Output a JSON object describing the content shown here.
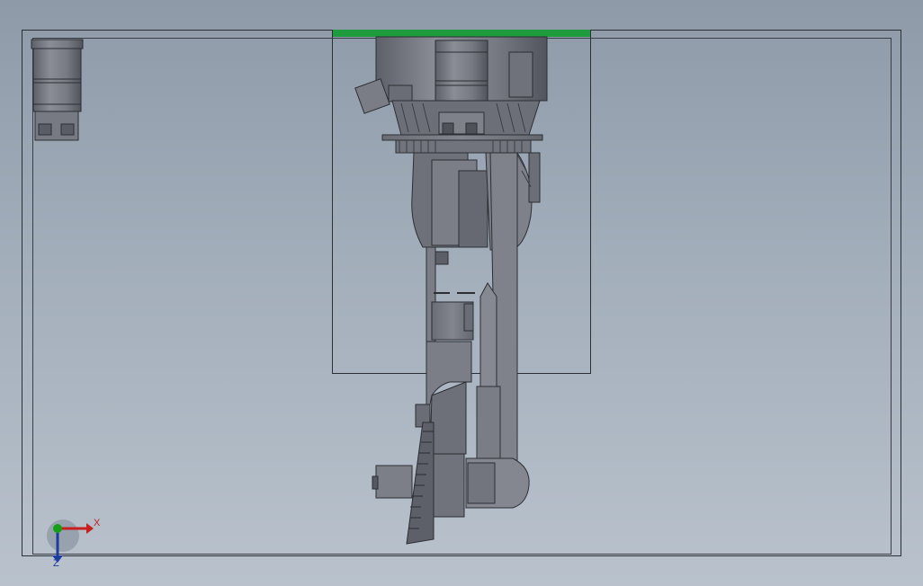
{
  "triad": {
    "x_label": "X",
    "z_label": "Z",
    "x_color": "#c81e1e",
    "y_color": "#14a014",
    "z_color": "#1e3ca0"
  },
  "colors": {
    "selection_bar": "#1e9b3c",
    "model_fill": "#7d8089",
    "model_dark": "#5f626b",
    "model_edge": "#2c2e33"
  }
}
